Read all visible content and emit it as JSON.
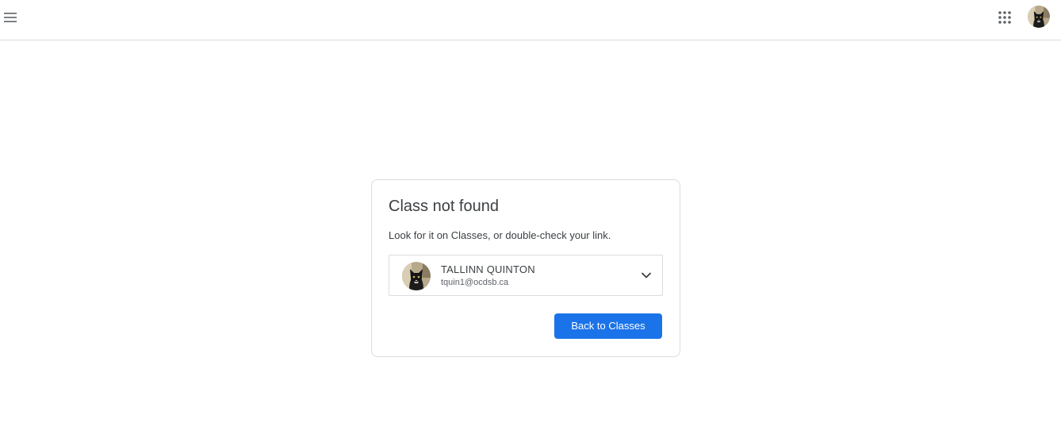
{
  "header": {
    "menu_icon": "hamburger-menu-icon",
    "apps_icon": "google-apps-grid-icon",
    "avatar": "user-avatar-cat"
  },
  "dialog": {
    "title": "Class not found",
    "message": "Look for it on Classes, or double-check your link.",
    "account": {
      "name": "TALLINN QUINTON",
      "email": "tquin1@ocdsb.ca",
      "dropdown_icon": "chevron-down-icon"
    },
    "back_button_label": "Back to Classes"
  },
  "colors": {
    "primary": "#1a73e8",
    "border": "#dadce0",
    "text": "#3c4043",
    "secondary_text": "#5f6368"
  }
}
